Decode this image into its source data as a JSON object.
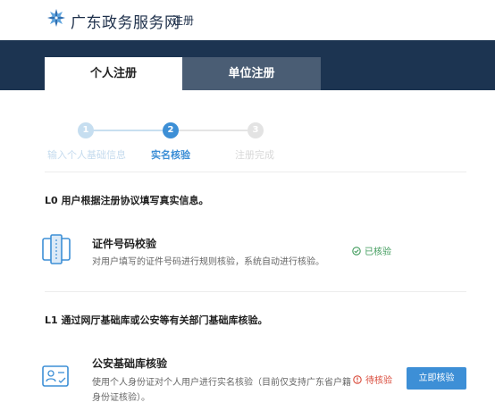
{
  "header": {
    "site_name": "广东政务服务网",
    "page_label": "注册",
    "logo_icon": "guangdong-logo-icon"
  },
  "tabs": [
    {
      "label": "个人注册",
      "active": true
    },
    {
      "label": "单位注册",
      "active": false
    }
  ],
  "steps": [
    {
      "number": "1",
      "label": "输入个人基础信息",
      "state": "done"
    },
    {
      "number": "2",
      "label": "实名核验",
      "state": "current"
    },
    {
      "number": "3",
      "label": "注册完成",
      "state": "pending"
    }
  ],
  "levels": [
    {
      "title": "L0 用户根据注册协议填写真实信息。",
      "item": {
        "icon": "id-card-icon",
        "title": "证件号码校验",
        "description": "对用户填写的证件号码进行规则核验，系统自动进行核验。",
        "status": "已核验",
        "status_icon": "check-circle-icon"
      }
    },
    {
      "title": "L1 通过网厅基础库或公安等有关部门基础库核验。",
      "item": {
        "icon": "id-badge-icon",
        "title": "公安基础库核验",
        "description": "使用个人身份证对个人用户进行实名核验（目前仅支持广东省户籍身份证核验）。",
        "status": "待核验",
        "status_icon": "alert-circle-icon",
        "button": "立即核验"
      }
    }
  ],
  "colors": {
    "banner": "#1c3451",
    "accent": "#3d8fd6",
    "ok": "#3e9a5a",
    "warn": "#d94a3a"
  }
}
